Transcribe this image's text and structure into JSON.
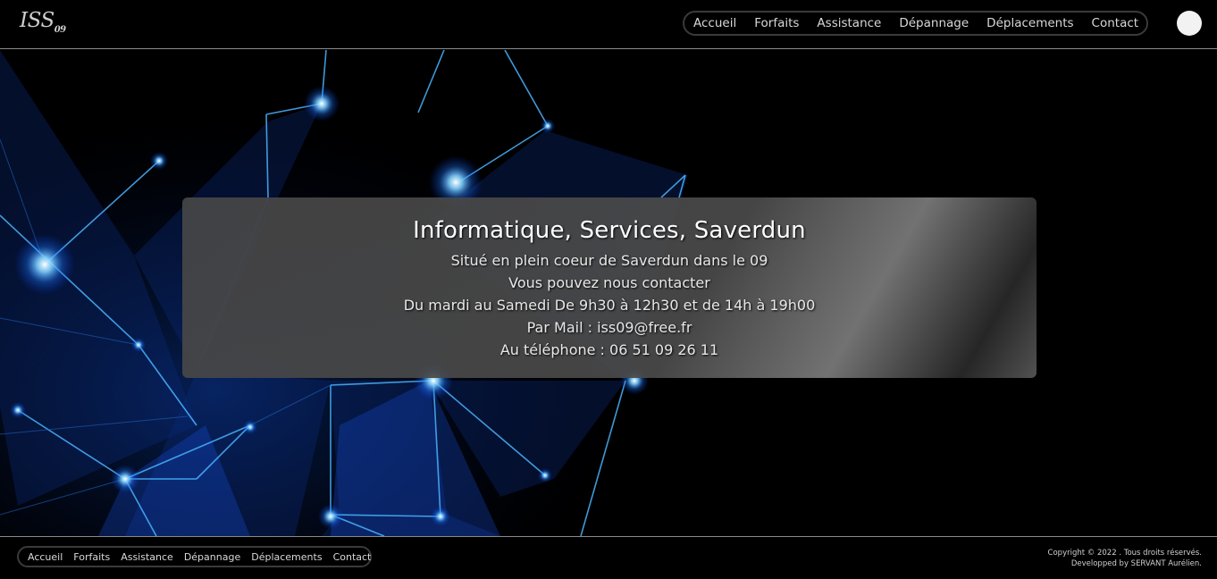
{
  "header": {
    "logo_main": "ISS",
    "logo_sub": "09",
    "nav": [
      "Accueil",
      "Forfaits",
      "Assistance",
      "Dépannage",
      "Déplacements",
      "Contact"
    ]
  },
  "hero": {
    "title": "Informatique, Services, Saverdun",
    "lines": [
      "Situé en plein coeur de Saverdun dans le 09",
      "Vous pouvez nous contacter",
      "Du mardi au Samedi De 9h30 à 12h30 et de 14h à 19h00",
      "Par Mail : iss09@free.fr",
      "Au téléphone : 06 51 09 26 11"
    ]
  },
  "footer": {
    "nav": [
      "Accueil",
      "Forfaits",
      "Assistance",
      "Dépannage",
      "Déplacements",
      "Contact"
    ],
    "copyright": "Copyright © 2022 . Tous droits réservés.",
    "developer": "Developped by SERVANT Aurélien."
  },
  "colors": {
    "background": "#000000",
    "node_glow": "#1e90ff",
    "panel": "#4a4a4a"
  }
}
